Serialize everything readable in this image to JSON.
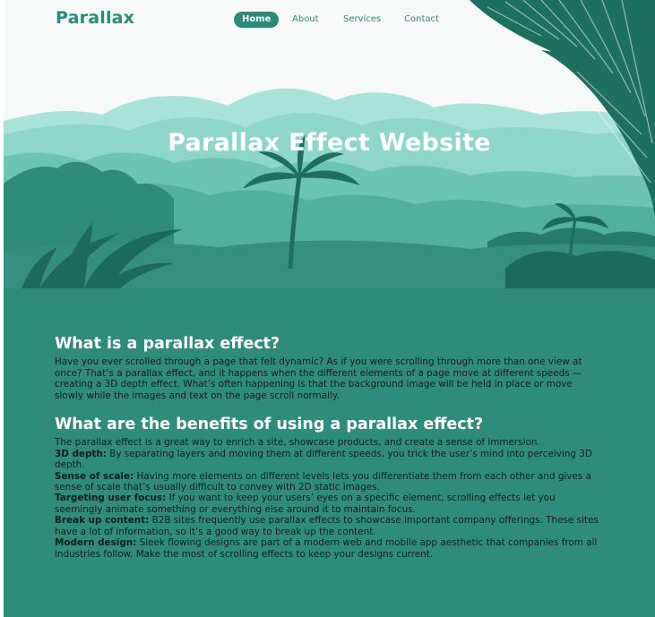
{
  "brand": {
    "name": "Parallax"
  },
  "nav": {
    "items": [
      {
        "label": "Home"
      },
      {
        "label": "About"
      },
      {
        "label": "Services"
      },
      {
        "label": "Contact"
      }
    ],
    "active": "Home"
  },
  "hero": {
    "title": "Parallax Effect Website"
  },
  "section1": {
    "heading": "What is a parallax effect?",
    "body": "Have you ever scrolled through a page that felt dynamic? As if you were scrolling through more than one view at once? That’s a parallax effect, and it happens when the different elements of a page move at different speeds — creating a 3D depth effect. What’s often happening is that the background image will be held in place or move slowly while the images and text on the page scroll normally."
  },
  "section2": {
    "heading": "What are the benefits of using a parallax effect?",
    "intro": "The parallax effect is a great way to enrich a site, showcase products, and create a sense of immersion.",
    "items": [
      {
        "term": "3D depth:",
        "text": " By separating layers and moving them at different speeds, you trick the user’s mind into perceiving 3D depth."
      },
      {
        "term": "Sense of scale:",
        "text": " Having more elements on different levels lets you differentiate them from each other and gives a sense of scale that’s usually difficult to convey with 2D static images."
      },
      {
        "term": "Targeting user focus:",
        "text": " If you want to keep your users’ eyes on a specific element, scrolling effects let you seemingly animate something or everything else around it to maintain focus."
      },
      {
        "term": "Break up content:",
        "text": " B2B sites frequently use parallax effects to showcase important company offerings. These sites have a lot of information, so it’s a good way to break up the content."
      },
      {
        "term": "Modern design:",
        "text": " Sleek flowing designs are part of a modern web and mobile app aesthetic that companies from all industries follow. Make the most of scrolling effects to keep your designs current."
      }
    ]
  },
  "colors": {
    "accent": "#2b8a78",
    "background": "#2f8c7b",
    "heading": "#ffffff",
    "text": "#0e1e1b"
  }
}
